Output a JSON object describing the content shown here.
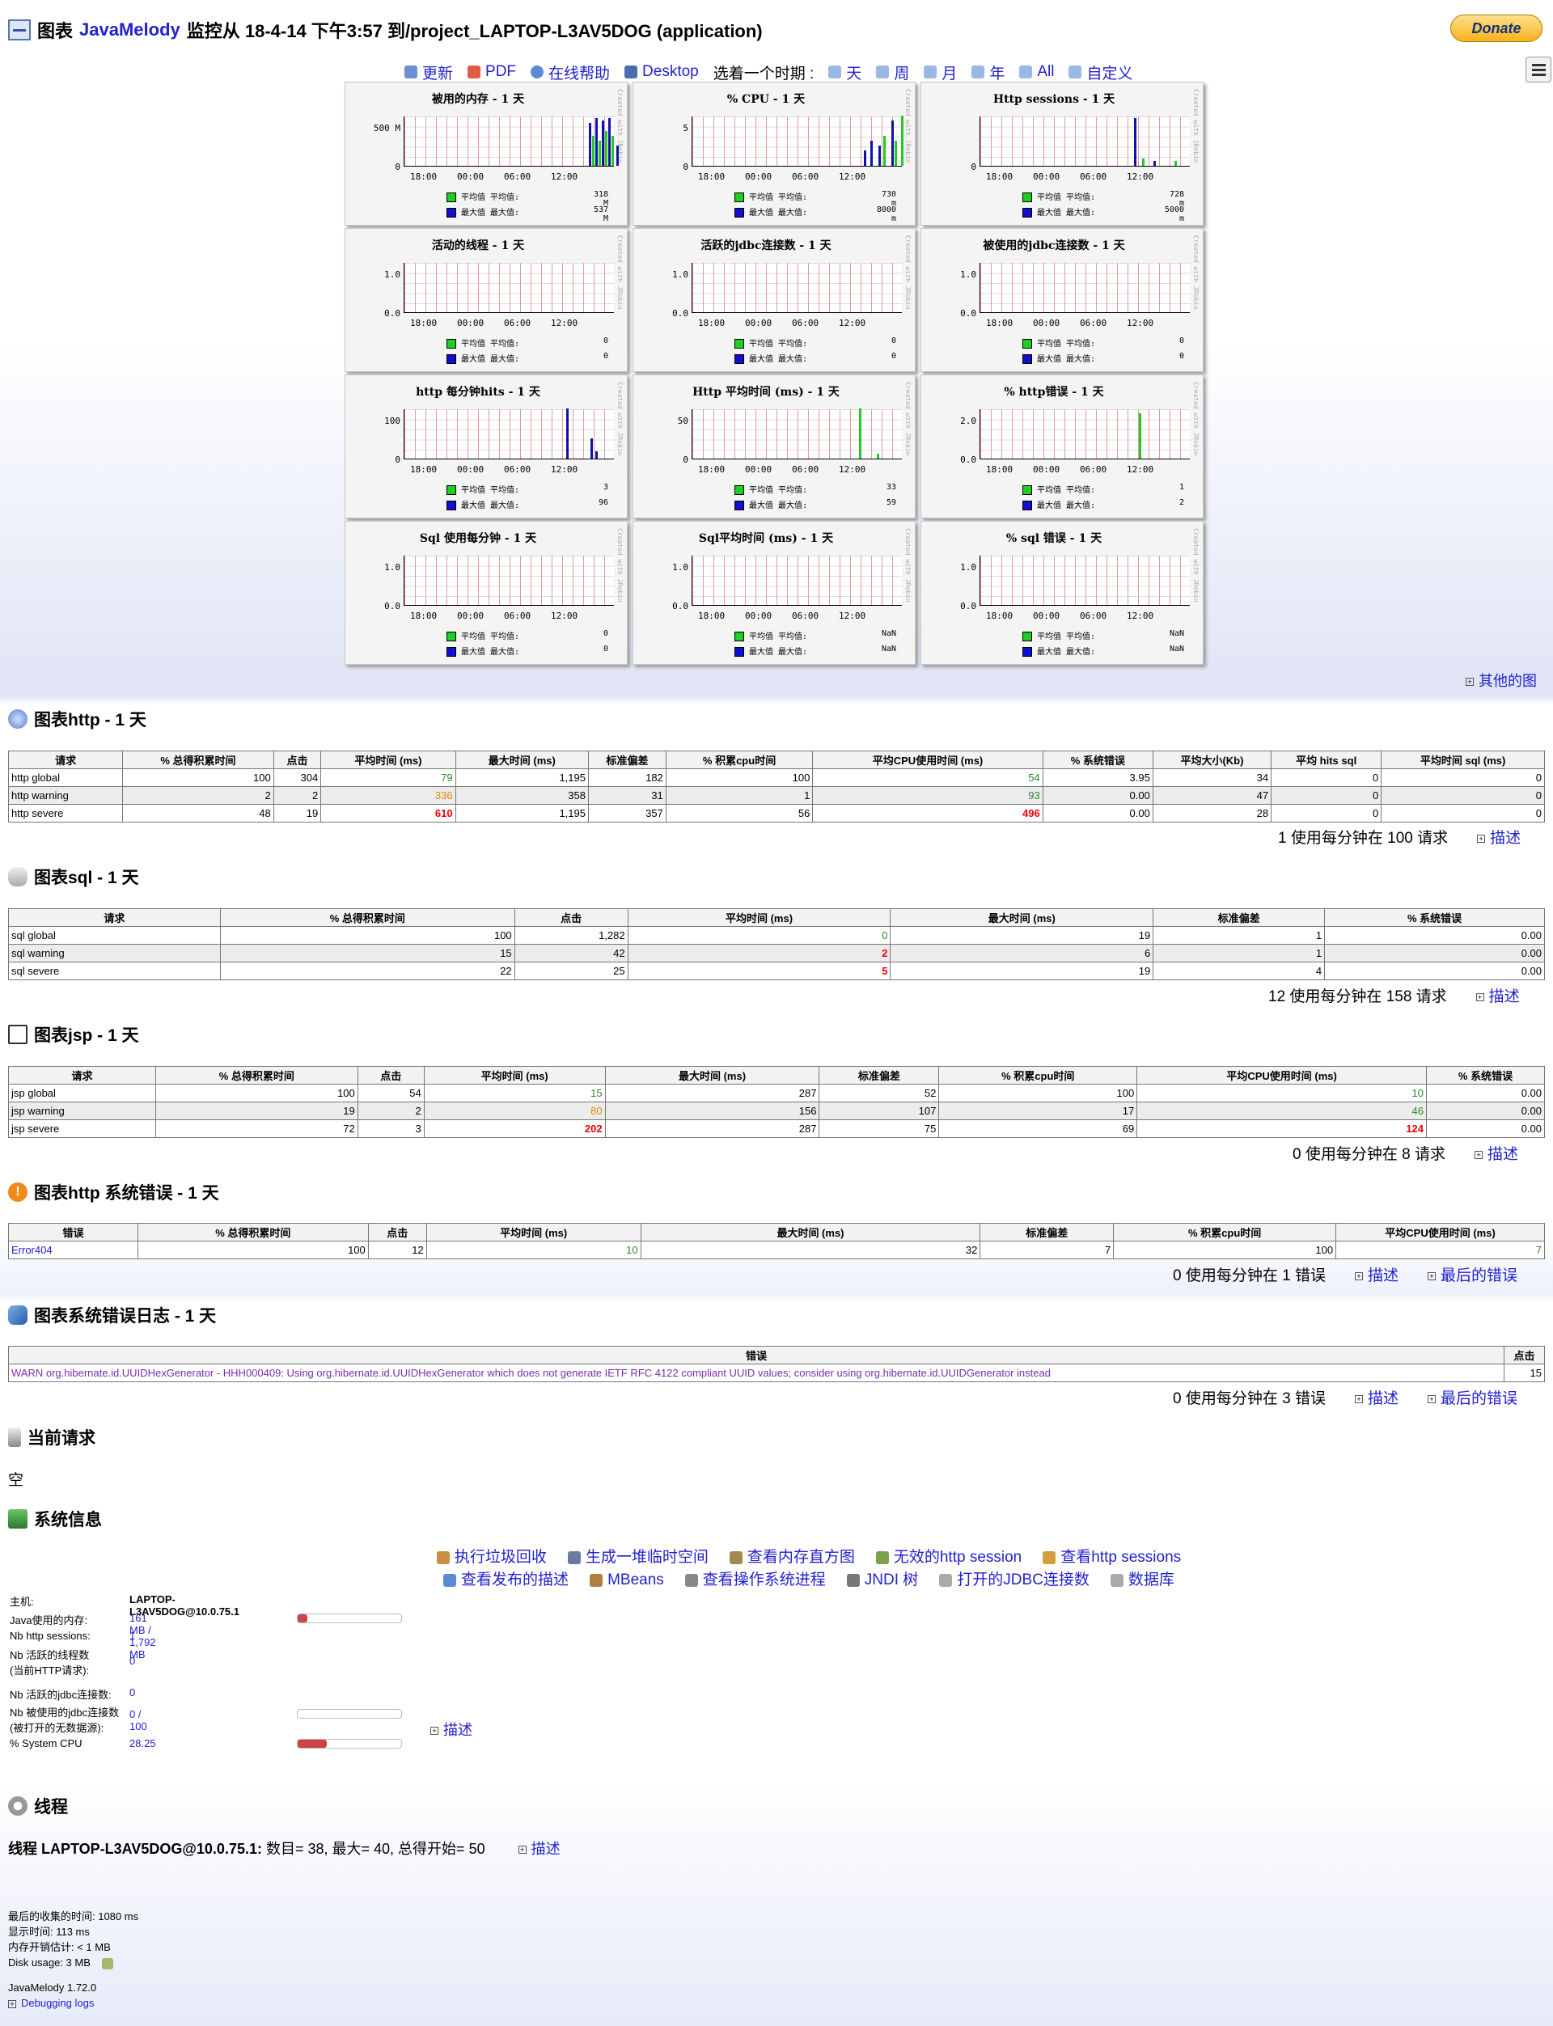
{
  "header": {
    "prefix": "图表",
    "brand": "JavaMelody",
    "title": "监控从 18-4-14 下午3:57 到/project_LAPTOP-L3AV5DOG (application)",
    "donate": "Donate"
  },
  "nav": {
    "refresh": "更新",
    "pdf": "PDF",
    "help": "在线帮助",
    "desktop": "Desktop",
    "choose": "选着一个时期 :",
    "day": "天",
    "week": "周",
    "month": "月",
    "year": "年",
    "all": "All",
    "custom": "自定义"
  },
  "charts": [
    {
      "title": "被用的内存 - 1 天",
      "ytop": "500 M",
      "ybot": "0",
      "avg": "318 M",
      "max": "537 M"
    },
    {
      "title": "% CPU - 1 天",
      "ytop": "5",
      "ybot": "0",
      "avg": "730 m",
      "max": "8000 m"
    },
    {
      "title": "Http sessions - 1 天",
      "ytop": "",
      "ybot": "0",
      "avg": "728 m",
      "max": "5000 m"
    },
    {
      "title": "活动的线程 - 1 天",
      "ytop": "1.0",
      "ybot": "0.0",
      "avg": "0",
      "max": "0"
    },
    {
      "title": "活跃的jdbc连接数 - 1 天",
      "ytop": "1.0",
      "ybot": "0.0",
      "avg": "0",
      "max": "0"
    },
    {
      "title": "被使用的jdbc连接数 - 1 天",
      "ytop": "1.0",
      "ybot": "0.0",
      "avg": "0",
      "max": "0"
    },
    {
      "title": "http 每分钟hits - 1 天",
      "ytop": "100",
      "ybot": "0",
      "avg": "3",
      "max": "96"
    },
    {
      "title": "Http 平均时间 (ms) - 1 天",
      "ytop": "50",
      "ybot": "0",
      "avg": "33",
      "max": "59"
    },
    {
      "title": "% http错误 - 1 天",
      "ytop": "2.0",
      "ybot": "0.0",
      "avg": "1",
      "max": "2"
    },
    {
      "title": "Sql 使用每分钟 - 1 天",
      "ytop": "1.0",
      "ybot": "0.0",
      "avg": "0",
      "max": "0"
    },
    {
      "title": "Sql平均时间 (ms) - 1 天",
      "ytop": "1.0",
      "ybot": "0.0",
      "avg": "NaN",
      "max": "NaN"
    },
    {
      "title": "% sql 错误 - 1 天",
      "ytop": "1.0",
      "ybot": "0.0",
      "avg": "NaN",
      "max": "NaN"
    }
  ],
  "chart_common": {
    "x_ticks": [
      "18:00",
      "00:00",
      "06:00",
      "12:00"
    ],
    "avg_label": "平均值",
    "max_label": "最大值",
    "avg_label2": "平均值:",
    "max_label2": "最大值:",
    "side": "Created with JRobin"
  },
  "other_charts": "其他的图",
  "http": {
    "title": "图表http - 1 天",
    "cols": [
      "请求",
      "% 总得积累时间",
      "点击",
      "平均时间 (ms)",
      "最大时间 (ms)",
      "标准偏差",
      "% 积累cpu时间",
      "平均CPU使用时间 (ms)",
      "% 系统错误",
      "平均大小(Kb)",
      "平均 hits sql",
      "平均时间 sql (ms)"
    ],
    "rows": [
      [
        "http global",
        "100",
        "304",
        "79",
        "1,195",
        "182",
        "100",
        "54",
        "3.95",
        "34",
        "0",
        "0"
      ],
      [
        "http warning",
        "2",
        "2",
        "336",
        "358",
        "31",
        "1",
        "93",
        "0.00",
        "47",
        "0",
        "0"
      ],
      [
        "http severe",
        "48",
        "19",
        "610",
        "1,195",
        "357",
        "56",
        "496",
        "0.00",
        "28",
        "0",
        "0"
      ]
    ],
    "note": "1 使用每分钟在 100 请求",
    "desc": "描述"
  },
  "sql": {
    "title": "图表sql - 1 天",
    "cols": [
      "请求",
      "% 总得积累时间",
      "点击",
      "平均时间 (ms)",
      "最大时间 (ms)",
      "标准偏差",
      "% 系统错误"
    ],
    "rows": [
      [
        "sql global",
        "100",
        "1,282",
        "0",
        "19",
        "1",
        "0.00"
      ],
      [
        "sql warning",
        "15",
        "42",
        "2",
        "6",
        "1",
        "0.00"
      ],
      [
        "sql severe",
        "22",
        "25",
        "5",
        "19",
        "4",
        "0.00"
      ]
    ],
    "note": "12 使用每分钟在 158 请求",
    "desc": "描述"
  },
  "jsp": {
    "title": "图表jsp - 1 天",
    "cols": [
      "请求",
      "% 总得积累时间",
      "点击",
      "平均时间 (ms)",
      "最大时间 (ms)",
      "标准偏差",
      "% 积累cpu时间",
      "平均CPU使用时间 (ms)",
      "% 系统错误"
    ],
    "rows": [
      [
        "jsp global",
        "100",
        "54",
        "15",
        "287",
        "52",
        "100",
        "10",
        "0.00"
      ],
      [
        "jsp warning",
        "19",
        "2",
        "80",
        "156",
        "107",
        "17",
        "46",
        "0.00"
      ],
      [
        "jsp severe",
        "72",
        "3",
        "202",
        "287",
        "75",
        "69",
        "124",
        "0.00"
      ]
    ],
    "note": "0 使用每分钟在 8 请求",
    "desc": "描述"
  },
  "err": {
    "title": "图表http 系统错误 - 1 天",
    "cols": [
      "错误",
      "% 总得积累时间",
      "点击",
      "平均时间 (ms)",
      "最大时间 (ms)",
      "标准偏差",
      "% 积累cpu时间",
      "平均CPU使用时间 (ms)"
    ],
    "rows": [
      [
        "Error404",
        "100",
        "12",
        "10",
        "32",
        "7",
        "100",
        "7"
      ]
    ],
    "note": "0 使用每分钟在 1 错误",
    "desc": "描述",
    "last": "最后的错误"
  },
  "log": {
    "title": "图表系统错误日志 - 1 天",
    "cols": [
      "错误",
      "点击"
    ],
    "rows": [
      [
        "WARN org.hibernate.id.UUIDHexGenerator - HHH000409: Using org.hibernate.id.UUIDHexGenerator which does not generate IETF RFC 4122 compliant UUID values; consider using org.hibernate.id.UUIDGenerator instead",
        "15"
      ]
    ],
    "note": "0 使用每分钟在 3 错误",
    "desc": "描述",
    "last": "最后的错误"
  },
  "current": {
    "title": "当前请求",
    "empty": "空"
  },
  "sys": {
    "title": "系统信息",
    "links1": [
      "执行垃圾回收",
      "生成一堆临时空间",
      "查看内存直方图",
      "无效的http session",
      "查看http sessions"
    ],
    "links2": [
      "查看发布的描述",
      "MBeans",
      "查看操作系统进程",
      "JNDI 树",
      "打开的JDBC连接数",
      "数据库"
    ],
    "host_k": "主机:",
    "host_v": "LAPTOP-L3AV5DOG@10.0.75.1",
    "mem_k": "Java使用的内存:",
    "mem_v": "161 MB / 1,792 MB",
    "mem_frac": 0.09,
    "sess_k": "Nb http sessions:",
    "sess_v": "1",
    "thr_k1": "Nb 活跃的线程数",
    "thr_k2": "(当前HTTP请求):",
    "thr_v": "0",
    "jdbc_k": "Nb 活跃的jdbc连接数:",
    "jdbc_v": "0",
    "used_k1": "Nb 被使用的jdbc连接数",
    "used_k2": "(被打开的无数据源):",
    "used_v": "0 / 100",
    "used_frac": 0,
    "cpu_k": "% System CPU",
    "cpu_v": "28.25",
    "cpu_frac": 0.28,
    "desc": "描述"
  },
  "threads": {
    "title": "线程",
    "line_b": "线程 LAPTOP-L3AV5DOG@10.0.75.1:",
    "line": " 数目= 38, 最大= 40, 总得开始= 50",
    "desc": "描述"
  },
  "footer": {
    "collect": "最后的收集的时间: 1080 ms",
    "display": "显示时间: 113 ms",
    "mem": "内存开销估计: < 1 MB",
    "disk": "Disk usage: 3 MB",
    "ver": "JavaMelody 1.72.0",
    "debug": "Debugging logs"
  }
}
